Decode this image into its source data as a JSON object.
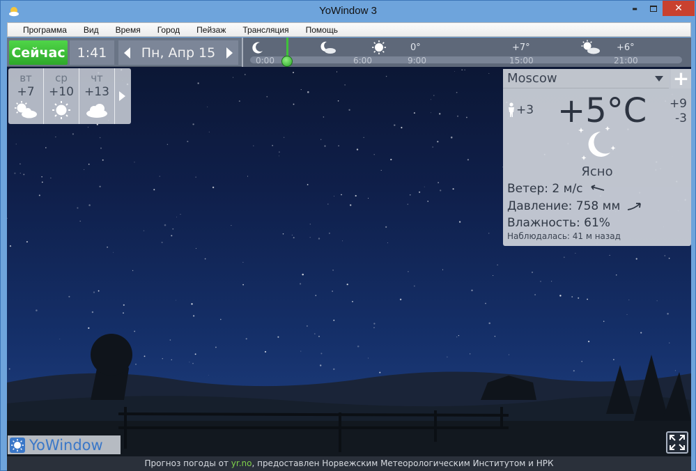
{
  "window": {
    "title": "YoWindow 3",
    "minimize_glyph": "▬",
    "close_glyph": "✕"
  },
  "menu": [
    "Программа",
    "Вид",
    "Время",
    "Город",
    "Пейзаж",
    "Трансляция",
    "Помощь"
  ],
  "timebar": {
    "now_label": "Сейчас",
    "time": "1:41",
    "date": "Пн, Апр 15",
    "timeline_labels": [
      "0:00",
      "6:00",
      "9:00",
      "15:00",
      "21:00"
    ],
    "timeline_temps": [
      "0°",
      "+7°",
      "+6°"
    ],
    "timeline_icons": [
      "moon-icon",
      "moon-cloud-icon",
      "sun-icon",
      "sun-cloud-icon"
    ]
  },
  "forecast": [
    {
      "day": "вт",
      "temp": "+7",
      "icon": "partly-sunny-icon"
    },
    {
      "day": "ср",
      "temp": "+10",
      "icon": "sun-icon"
    },
    {
      "day": "чт",
      "temp": "+13",
      "icon": "cloud-icon"
    }
  ],
  "city": {
    "name": "Moscow",
    "add_label": "+",
    "feels_like": "+3",
    "temperature": "+5°C",
    "temp_high": "+9",
    "temp_low": "-3",
    "condition": "Ясно",
    "wind": "Ветер:  2 м/с",
    "pressure": "Давление:  758 мм",
    "humidity": "Влажность:  61%",
    "observed": "Наблюдалась:  41 м назад"
  },
  "footer": {
    "logo": "YoWindow",
    "credit_prefix": "Прогноз погоды от ",
    "credit_link": "yr.no",
    "credit_suffix": ", предоставлен Норвежским Метеорологическим Институтом и НРК"
  },
  "colors": {
    "now_button": "#3fc23a",
    "sky_top": "#0b1530",
    "sky_bottom": "#1b3977",
    "close_button": "#c9412f"
  }
}
